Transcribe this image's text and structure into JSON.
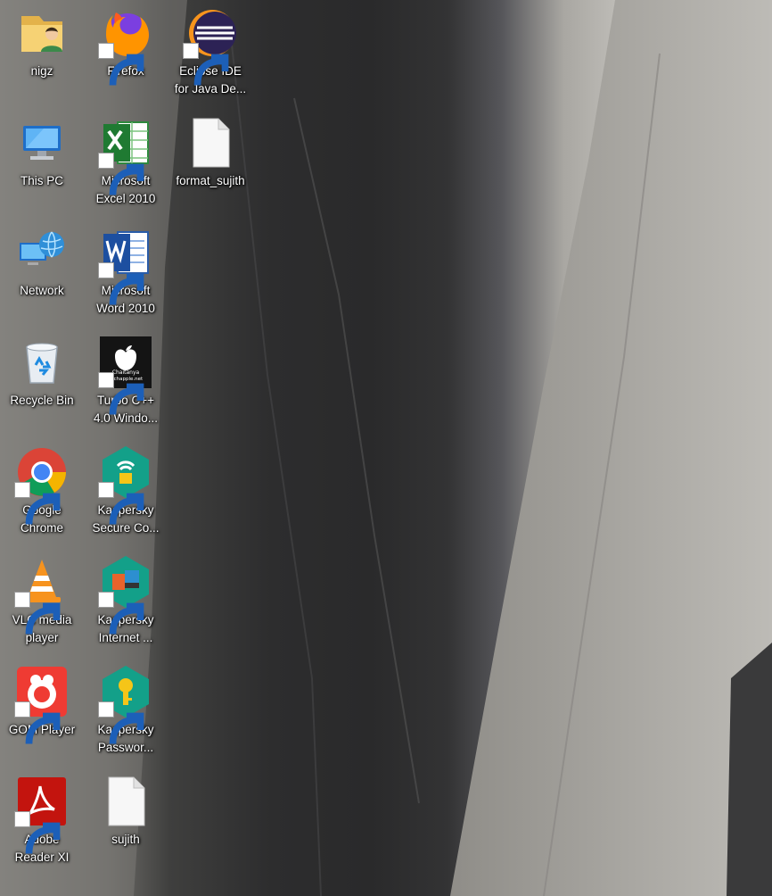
{
  "desktop": {
    "col1": [
      {
        "label1": "nigz",
        "label2": "",
        "icon": "user-folder-icon"
      },
      {
        "label1": "This PC",
        "label2": "",
        "icon": "computer-icon"
      },
      {
        "label1": "Network",
        "label2": "",
        "icon": "network-icon"
      },
      {
        "label1": "Recycle Bin",
        "label2": "",
        "icon": "recycle-bin-icon"
      },
      {
        "label1": "Google",
        "label2": "Chrome",
        "icon": "chrome-icon"
      },
      {
        "label1": "VLC media",
        "label2": "player",
        "icon": "vlc-icon"
      },
      {
        "label1": "GOM Player",
        "label2": "",
        "icon": "gom-player-icon"
      },
      {
        "label1": "Adobe",
        "label2": "Reader XI",
        "icon": "adobe-reader-icon"
      }
    ],
    "col2": [
      {
        "label1": "Firefox",
        "label2": "",
        "icon": "firefox-icon"
      },
      {
        "label1": "Microsoft",
        "label2": "Excel 2010",
        "icon": "excel-icon"
      },
      {
        "label1": "Microsoft",
        "label2": "Word 2010",
        "icon": "word-icon"
      },
      {
        "label1": "Turbo C++",
        "label2": "4.0 Windo...",
        "icon": "turbo-cpp-icon",
        "badge1": "Chaitanya",
        "badge2": "Techapple.net"
      },
      {
        "label1": "Kaspersky",
        "label2": "Secure Co...",
        "icon": "kaspersky-secure-icon"
      },
      {
        "label1": "Kaspersky",
        "label2": "Internet ...",
        "icon": "kaspersky-internet-icon"
      },
      {
        "label1": "Kaspersky",
        "label2": "Passwor...",
        "icon": "kaspersky-password-icon"
      },
      {
        "label1": "sujith",
        "label2": "",
        "icon": "text-file-icon"
      }
    ],
    "col3": [
      {
        "label1": "Eclipse IDE",
        "label2": "for Java De...",
        "icon": "eclipse-icon"
      },
      {
        "label1": "format_sujith",
        "label2": "",
        "icon": "text-file-icon"
      }
    ]
  }
}
